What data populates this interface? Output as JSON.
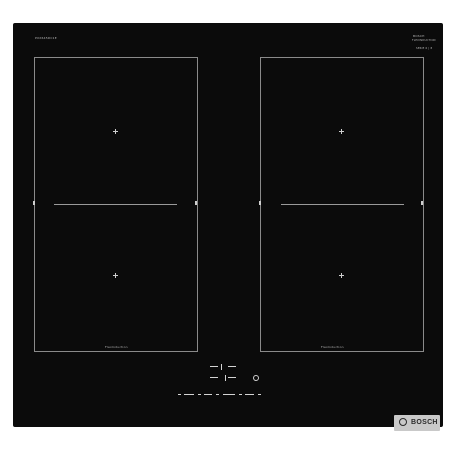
{
  "product": {
    "model_code": "PXX645DC1E",
    "brand": "BOSCH",
    "top_badge_line1": "BOSCH",
    "top_badge_line2": "FLEXINDUCTION",
    "top_badge_line3": "SERIE 6 | 8",
    "zone_label_left": "FlexInduction",
    "zone_label_right": "FlexInduction"
  },
  "colors": {
    "glass": "#0b0b0b",
    "zone_outline": "#8a8a8a",
    "logo_plate": "#c9c9c9"
  },
  "icons": {
    "brand_emblem": "bosch-ring-icon",
    "zone_center": "crosshair-icon",
    "power": "power-icon"
  }
}
